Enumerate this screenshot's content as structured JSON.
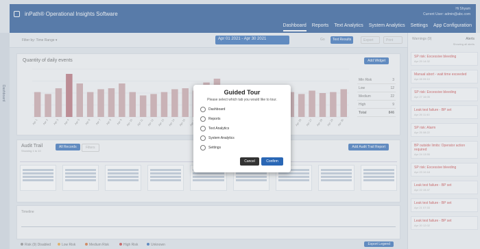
{
  "header": {
    "title": "inPath® Operational Insights Software",
    "user_line1": "Hi Shyam",
    "user_line2": "Current User: admin@abc.com",
    "nav": [
      {
        "label": "Dashboard",
        "active": true
      },
      {
        "label": "Reports",
        "active": false
      },
      {
        "label": "Text Analytics",
        "active": false
      },
      {
        "label": "System Analytics",
        "active": false
      },
      {
        "label": "Settings",
        "active": false
      },
      {
        "label": "App Configuration",
        "active": false
      }
    ]
  },
  "left_rail": {
    "label": "Dashboard"
  },
  "filter_bar": {
    "label": "Filter by: Time Range ▾",
    "date_range": "Apr 01 2021 - Apr 30 2021",
    "btn_a": "Go",
    "btn_b": "Text Results",
    "btn_c": "Export",
    "btn_d": "Print"
  },
  "chart_panel": {
    "title": "Quantity of daily events",
    "button": "Add Widget",
    "summary": [
      {
        "label": "Min Risk",
        "value": "3"
      },
      {
        "label": "Low",
        "value": "12"
      },
      {
        "label": "Medium",
        "value": "22"
      },
      {
        "label": "High",
        "value": "9"
      },
      {
        "label": "Total",
        "value": "846"
      }
    ]
  },
  "audit_panel": {
    "title": "Audit Trail",
    "subtitle": "Showing 1 to 10",
    "btn_primary": "All Records",
    "btn_secondary": "Filters",
    "btn_right": "Add Audit Trail Report"
  },
  "timeline": {
    "label": "Timeline"
  },
  "legend": {
    "items": [
      "Risk (9) Disabled",
      "Low Risk",
      "Medium Risk",
      "High Risk",
      "Unknown"
    ],
    "button": "Export Legend"
  },
  "right_panel": {
    "head_left": "Warnings (9)",
    "head_right": "Alerts",
    "head_right_sub": "Showing all alerts",
    "alerts": [
      {
        "title": "SP risk: Excessive bleeding",
        "sub": "Apr 29 14:32"
      },
      {
        "title": "Manual abort - wait time exceeded",
        "sub": "Apr 28 09:10"
      },
      {
        "title": "SP risk: Excessive bleeding",
        "sub": "Apr 27 16:05"
      },
      {
        "title": "Leak test failure - BP set",
        "sub": "Apr 26 11:40"
      },
      {
        "title": "SP risk: Alarm",
        "sub": "Apr 25 08:22"
      },
      {
        "title": "BP outside limits: Operator action required",
        "sub": "Apr 24 13:55"
      },
      {
        "title": "SP risk: Excessive bleeding",
        "sub": "Apr 23 10:18"
      },
      {
        "title": "Leak test failure - BP set",
        "sub": "Apr 22 15:47"
      },
      {
        "title": "Leak test failure - BP set",
        "sub": "Apr 21 07:33"
      },
      {
        "title": "Leak test failure - BP set",
        "sub": "Apr 20 12:02"
      }
    ]
  },
  "modal": {
    "title": "Guided Tour",
    "subtitle": "Please select which tab you would like to tour.",
    "options": [
      "Dashboard",
      "Reports",
      "Text Analytics",
      "System Analytics",
      "Settings"
    ],
    "cancel": "Cancel",
    "confirm": "Confirm"
  },
  "colors": {
    "header_bg": "#1c4f92",
    "accent": "#2a67b5",
    "bar": "#c9a3a6",
    "bar_highlight": "#b56a73",
    "alert_text": "#c73a3a"
  },
  "chart_data": {
    "type": "bar",
    "categories": [
      "Apr 1",
      "Apr 2",
      "Apr 3",
      "Apr 4",
      "Apr 5",
      "Apr 6",
      "Apr 7",
      "Apr 8",
      "Apr 9",
      "Apr 10",
      "Apr 11",
      "Apr 12",
      "Apr 13",
      "Apr 14",
      "Apr 15",
      "Apr 16",
      "Apr 17",
      "Apr 18",
      "Apr 19",
      "Apr 20",
      "Apr 21",
      "Apr 22",
      "Apr 23",
      "Apr 24",
      "Apr 25",
      "Apr 26",
      "Apr 27",
      "Apr 28",
      "Apr 29",
      "Apr 30"
    ],
    "values": [
      52,
      48,
      60,
      90,
      70,
      52,
      58,
      60,
      70,
      52,
      45,
      48,
      52,
      58,
      60,
      55,
      72,
      80,
      50,
      60,
      62,
      55,
      50,
      58,
      52,
      48,
      55,
      50,
      52,
      58
    ],
    "ylim": [
      0,
      100
    ]
  }
}
